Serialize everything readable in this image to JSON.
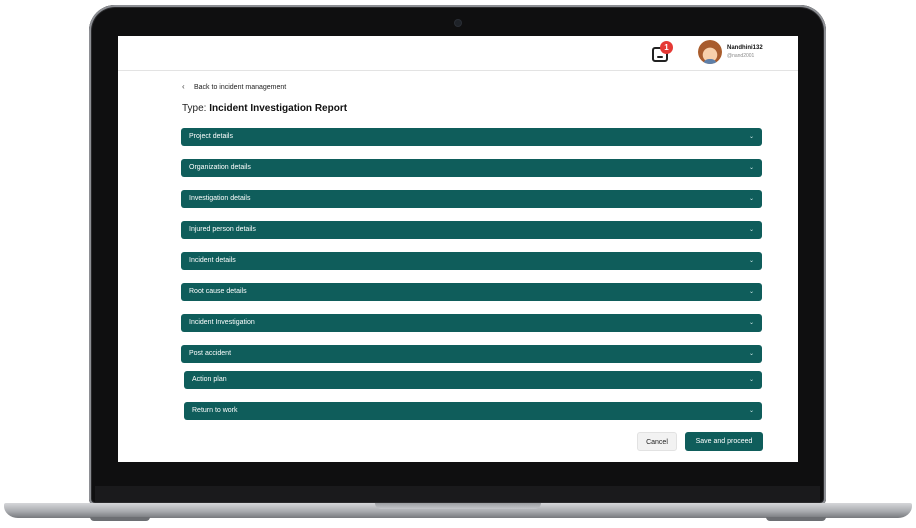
{
  "header": {
    "notification_count": "1",
    "user_name": "Nandhini132",
    "user_handle": "@nand2001"
  },
  "nav": {
    "back_label": "Back to incident management",
    "back_icon": "chevron-left-icon"
  },
  "page": {
    "type_prefix": "Type:",
    "type_value": "Incident Investigation Report"
  },
  "sections": [
    {
      "label": "Project details"
    },
    {
      "label": "Organization details"
    },
    {
      "label": "Investigation details"
    },
    {
      "label": "Injured person details"
    },
    {
      "label": "Incident details"
    },
    {
      "label": "Root cause details"
    },
    {
      "label": "Incident Investigation"
    },
    {
      "label": "Post accident"
    },
    {
      "label": "Action plan"
    },
    {
      "label": "Return to work"
    }
  ],
  "actions": {
    "cancel_label": "Cancel",
    "save_label": "Save and proceed"
  },
  "colors": {
    "accent": "#0f5d5b",
    "badge": "#e53935"
  }
}
